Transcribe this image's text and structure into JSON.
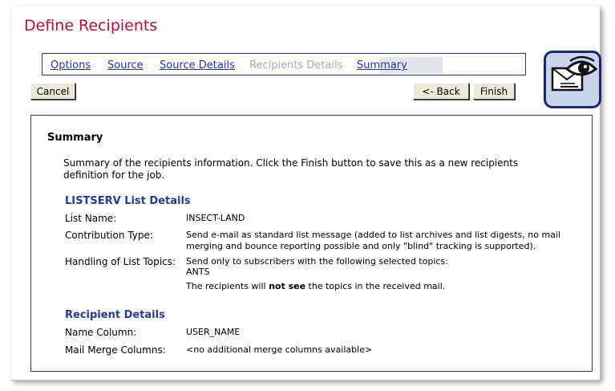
{
  "page_title": "Define Recipients",
  "tabs": [
    {
      "label": "Options",
      "state": "link"
    },
    {
      "label": "Source",
      "state": "link"
    },
    {
      "label": "Source Details",
      "state": "link"
    },
    {
      "label": "Recipients Details",
      "state": "disabled"
    },
    {
      "label": "Summary",
      "state": "active"
    }
  ],
  "buttons": {
    "cancel": "Cancel",
    "back": "<- Back",
    "finish": "Finish"
  },
  "logo_icon": "eye-envelope-icon",
  "summary": {
    "title": "Summary",
    "intro": "Summary of the recipients information. Click the Finish button to save this as a new recipients definition for the job.",
    "list_details": {
      "heading": "LISTSERV List Details",
      "list_name_label": "List Name:",
      "list_name_value": "INSECT-LAND",
      "contribution_label": "Contribution Type:",
      "contribution_value": "Send e-mail as standard list message (added to list archives and list digests, no mail merging and bounce reporting possible and only \"blind\" tracking is supported).",
      "topics_label": "Handling of List Topics:",
      "topics_value": "Send only to subscribers with the following selected topics:",
      "topics_list": "ANTS",
      "note_prefix": "The recipients will ",
      "note_bold": "not see",
      "note_suffix": " the topics in the received mail."
    },
    "recipient_details": {
      "heading": "Recipient Details",
      "name_col_label": "Name Column:",
      "name_col_value": "USER_NAME",
      "merge_label": "Mail Merge Columns:",
      "merge_value": "<no additional merge columns available>"
    }
  },
  "colors": {
    "title": "#b5103c",
    "link": "#1f3a9b",
    "heading": "#253a95",
    "border": "#283c8c"
  }
}
